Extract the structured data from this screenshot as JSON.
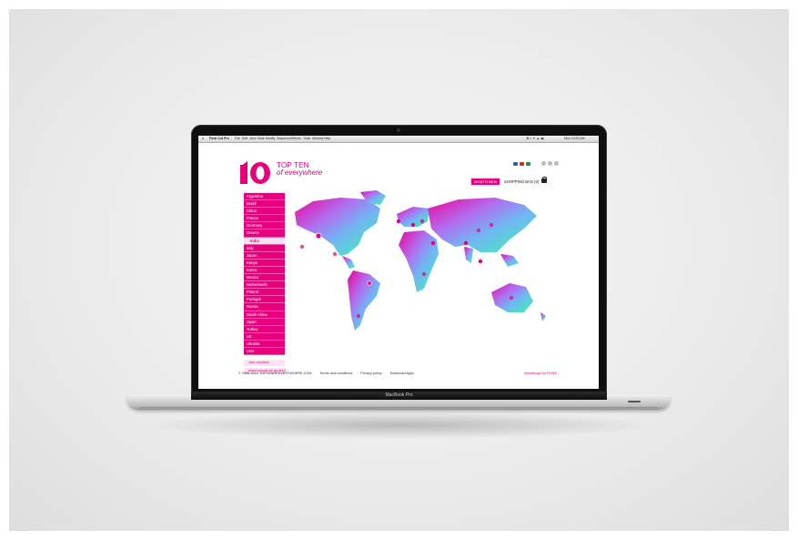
{
  "menubar": {
    "app_name": "Final Cut Pro",
    "menus": [
      "File",
      "Edit",
      "View",
      "Mark",
      "Modify",
      "Sequence",
      "Effects",
      "Tools",
      "Window",
      "Help"
    ],
    "clock": "Mon 10:53 AM"
  },
  "site": {
    "logo_number": "10",
    "logo_title": "TOP TEN",
    "logo_subtitle": "of everywhere",
    "whats_new": "WHAT'S NEW",
    "shopping_bag": "SHOPPING BAG (0)",
    "brand_color": "#e6007e"
  },
  "sidebar": {
    "countries": [
      "Argentina",
      "Brazil",
      "China",
      "France",
      "Germany",
      "Greece",
      "India",
      "Italy",
      "Japan",
      "Kenya",
      "Korea",
      "Mexico",
      "Netherlands",
      "Poland",
      "Portugal",
      "Russia",
      "South Africa",
      "Spain",
      "Turkey",
      "UK",
      "Ukraine",
      "USA"
    ],
    "selected": "India",
    "buttons": [
      "view countries",
      "where should we go next?"
    ]
  },
  "footer": {
    "copyright": "© 1999-2012 TOPTENOFEVERYWHERE.COM",
    "links": [
      "Terms and conditions",
      "Privacy policy",
      "Download Apps"
    ],
    "credit": "Webdesign by RUNA"
  },
  "device": {
    "label": "MacBook Pro"
  }
}
